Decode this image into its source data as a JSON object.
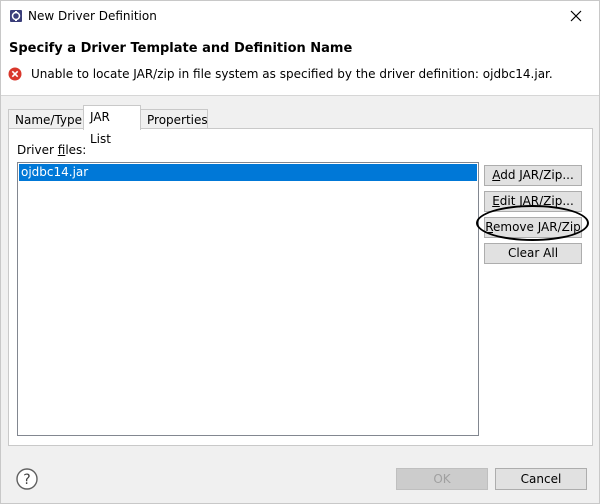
{
  "window": {
    "title": "New Driver Definition",
    "icon": "database-driver-icon"
  },
  "header": {
    "heading": "Specify a Driver Template and Definition Name",
    "error_message": "Unable to locate JAR/zip in file system as specified by the driver definition: ojdbc14.jar.",
    "error_icon": "error-icon"
  },
  "tabs": [
    {
      "label": "Name/Type",
      "active": false
    },
    {
      "label": "JAR List",
      "active": true
    },
    {
      "label": "Properties",
      "active": false
    }
  ],
  "jar_list": {
    "label_prefix": "Driver ",
    "label_mnemonic": "f",
    "label_suffix": "iles:",
    "items": [
      "ojdbc14.jar"
    ],
    "selected_color": "#0078d7"
  },
  "buttons": {
    "add": {
      "mnemonic": "A",
      "rest": "dd JAR/Zip..."
    },
    "edit": {
      "mnemonic": "E",
      "rest": "dit JAR/Zip..."
    },
    "remove": {
      "mnemonic": "R",
      "rest": "emove JAR/Zip"
    },
    "clear": {
      "label": "Clear All"
    }
  },
  "footer": {
    "ok_label": "OK",
    "cancel_label": "Cancel",
    "help_icon": "help-icon"
  }
}
